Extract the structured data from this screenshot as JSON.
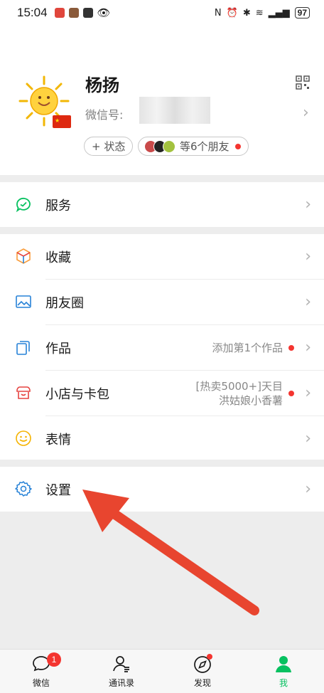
{
  "status_bar": {
    "time": "15:04",
    "battery": "97"
  },
  "profile": {
    "name": "杨扬",
    "wechat_id_label": "微信号:",
    "status_button": "+ 状态",
    "friends_text": "等6个朋友"
  },
  "menu": {
    "services": "服务",
    "favorites": "收藏",
    "moments": "朋友圈",
    "works": "作品",
    "works_hint": "添加第1个作品",
    "shop": "小店与卡包",
    "shop_hint_line1": "[热卖5000+]天目",
    "shop_hint_line2": "洪姑娘小香薯",
    "stickers": "表情",
    "settings": "设置"
  },
  "tabbar": {
    "chats": "微信",
    "chats_badge": "1",
    "contacts": "通讯录",
    "discover": "发现",
    "me": "我"
  },
  "colors": {
    "accent": "#07c160",
    "red": "#f43530",
    "annotation_arrow": "#e8452f"
  }
}
